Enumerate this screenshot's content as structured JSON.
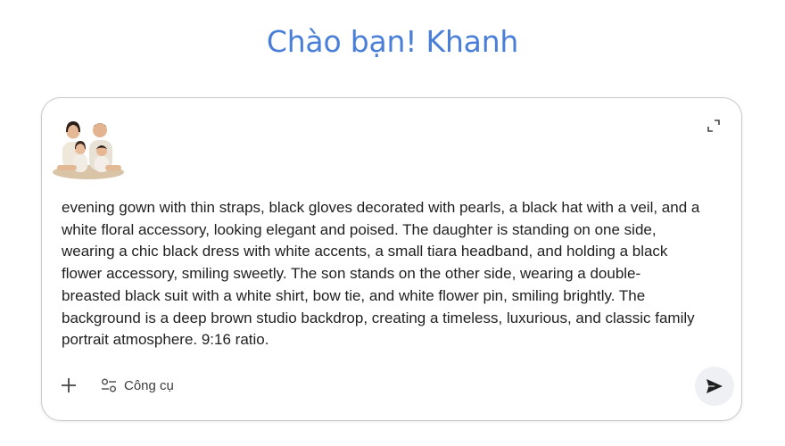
{
  "greeting": "Chào bạn! Khanh",
  "prompt": {
    "attachment_alt": "family-photo-thumbnail",
    "text": "evening gown with thin straps, black gloves decorated with pearls, a black hat with a veil, and a\nwhite floral accessory, looking elegant and poised. The daughter is standing on one side,\nwearing a chic black dress with white accents, a small tiara headband, and holding a black\nflower accessory, smiling sweetly. The son stands on the other side, wearing a double-\nbreasted black suit with a white shirt, bow tie, and white flower pin, smiling brightly. The\nbackground is a deep brown studio backdrop, creating a timeless, luxurious, and classic family\nportrait atmosphere. 9:16 ratio."
  },
  "toolbar": {
    "tools_label": "Công cụ"
  },
  "icons": {
    "expand": "expand-icon",
    "plus": "plus-icon",
    "tools": "tools-icon",
    "send": "send-icon"
  },
  "colors": {
    "greeting": "#4a7fd9",
    "border": "#c9c9c9",
    "send_bg": "#eef0f4"
  }
}
